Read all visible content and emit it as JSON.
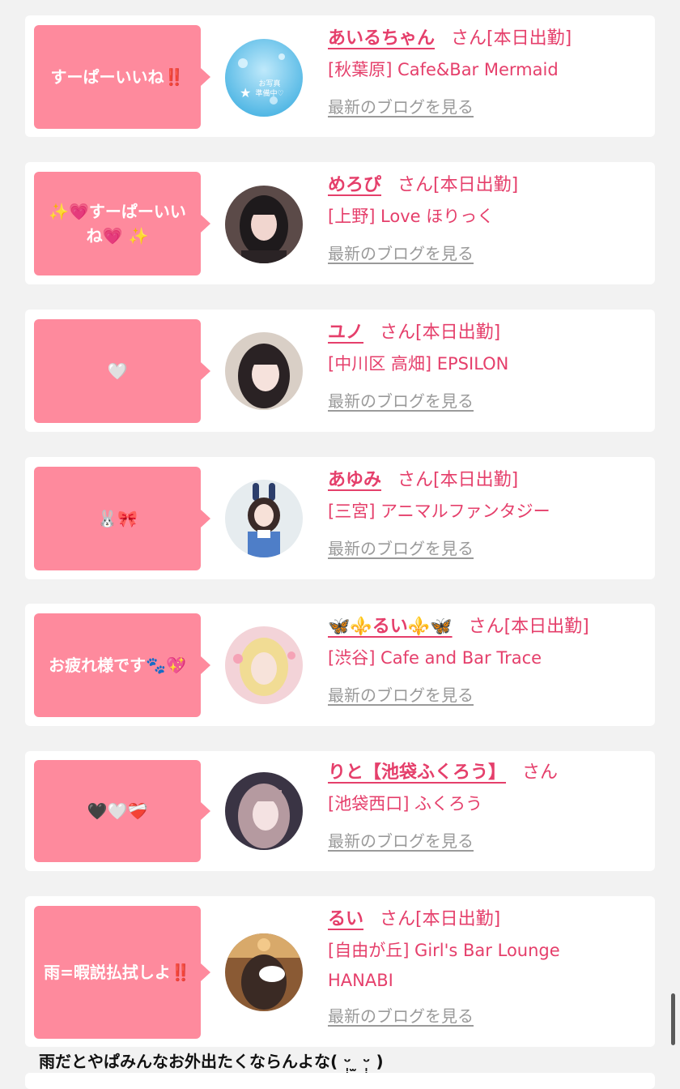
{
  "feed": [
    {
      "comment": "すーぱーいいね‼️",
      "name": "あいるちゃん",
      "honorific": "さん",
      "status": "[本日出勤]",
      "shop": "[秋葉原] Cafe&Bar Mermaid",
      "blog_link": "最新のブログを見る",
      "avatar_caption": "お写真準備中♡"
    },
    {
      "comment": "✨💗すーぱーいいね💗 ✨",
      "name": "めろぴ",
      "honorific": "さん",
      "status": "[本日出勤]",
      "shop": "[上野] Love ほりっく",
      "blog_link": "最新のブログを見る"
    },
    {
      "comment": "🤍",
      "name": "ユノ",
      "honorific": "さん",
      "status": "[本日出勤]",
      "shop": "[中川区 高畑] EPSILON",
      "blog_link": "最新のブログを見る"
    },
    {
      "comment": "🐰🎀",
      "name": "あゆみ",
      "honorific": "さん",
      "status": "[本日出勤]",
      "shop": "[三宮] アニマルファンタジー",
      "blog_link": "最新のブログを見る"
    },
    {
      "comment": "お疲れ様です🐾💖",
      "name": "🦋⚜️るい⚜️🦋",
      "honorific": "さん",
      "status": "[本日出勤]",
      "shop": "[渋谷] Cafe and Bar Trace",
      "blog_link": "最新のブログを見る"
    },
    {
      "comment": "🖤🤍❤️‍🩹",
      "name": "りと【池袋ふくろう】",
      "honorific": "さん",
      "status": "",
      "shop": "[池袋西口] ふくろう",
      "blog_link": "最新のブログを見る"
    },
    {
      "comment": "雨=暇説払拭しよ‼️",
      "name": "るい",
      "honorific": "さん",
      "status": "[本日出勤]",
      "shop": "[自由が丘] Girl's Bar Lounge HANABI",
      "blog_link": "最新のブログを見る"
    }
  ],
  "next_post_text": "雨だとやぱみんなお外出たくならんよな(   ᵕ̩̩ ̫ ᵕ̩̩   )"
}
